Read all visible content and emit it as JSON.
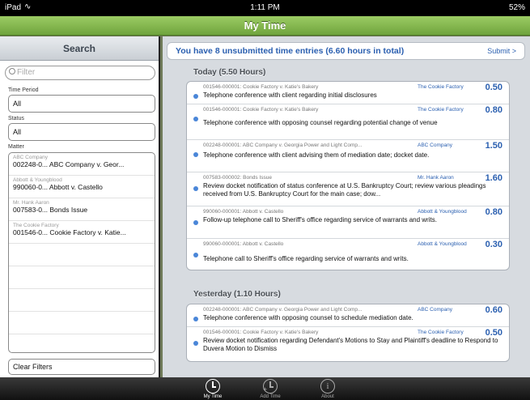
{
  "status_bar": {
    "device": "iPad",
    "time": "1:11 PM",
    "battery": "52%"
  },
  "nav": {
    "title": "My Time"
  },
  "search": {
    "header": "Search",
    "filter_placeholder": "Filter",
    "time_period_label": "Time Period",
    "time_period_value": "All",
    "status_label": "Status",
    "status_value": "All",
    "matter_label": "Matter",
    "matters": [
      {
        "client": "ABC Company",
        "name": "002248-0... ABC Company v. Geor..."
      },
      {
        "client": "Abbott & Youngblood",
        "name": "990060-0... Abbott v. Castello"
      },
      {
        "client": "Mr. Hank Aaron",
        "name": "007583-0... Bonds Issue"
      },
      {
        "client": "The Cookie Factory",
        "name": "001546-0... Cookie Factory v. Katie..."
      }
    ],
    "clear_filters": "Clear Filters"
  },
  "summary": {
    "message": "You have 8 unsubmitted time entries (6.60 hours in total)",
    "submit": "Submit >"
  },
  "sections": [
    {
      "header": "Today   (5.50 Hours)",
      "entries": [
        {
          "matter": "001546-000001: Cookie Factory v. Katie's Bakery",
          "client": "The Cookie Factory",
          "hours": "0.50",
          "description": "Telephone conference with client regarding initial disclosures"
        },
        {
          "matter": "001546-000001: Cookie Factory v. Katie's Bakery",
          "client": "The Cookie Factory",
          "hours": "0.80",
          "description": "Telephone conference with opposing counsel regarding potential change of venue"
        },
        {
          "matter": "002248-000001: ABC Company v. Georgia Power and Light Comp...",
          "client": "ABC Company",
          "hours": "1.50",
          "description": "Telephone conference with client advising them of mediation date; docket date."
        },
        {
          "matter": "007583-000002: Bonds Issue",
          "client": "Mr. Hank Aaron",
          "hours": "1.60",
          "description": "Review docket notification of status conference at U.S. Bankruptcy Court; review various pleadings received from U.S. Bankruptcy Court for the main case; dow..."
        },
        {
          "matter": "990060-000001: Abbott v. Castello",
          "client": "Abbott & Youngblood",
          "hours": "0.80",
          "description": "Follow-up telephone call to Sheriff's office regarding service of warrants and writs."
        },
        {
          "matter": "990060-000001: Abbott v. Castello",
          "client": "Abbott & Youngblood",
          "hours": "0.30",
          "description": "Telephone call to Sheriff's office regarding service of warrants and writs."
        }
      ]
    },
    {
      "header": "Yesterday   (1.10 Hours)",
      "entries": [
        {
          "matter": "002248-000001: ABC Company v. Georgia Power and Light Comp...",
          "client": "ABC Company",
          "hours": "0.60",
          "description": "Telephone conference with opposing counsel to schedule mediation date."
        },
        {
          "matter": "001546-000001: Cookie Factory v. Katie's Bakery",
          "client": "The Cookie Factory",
          "hours": "0.50",
          "description": "Review docket notification regarding Defendant's Motions to Stay and Plaintiff's deadline to Respond to Duvera Motion to Dismiss"
        }
      ]
    }
  ],
  "tabs": [
    {
      "label": "My Time",
      "icon": "clock-icon"
    },
    {
      "label": "Add Time",
      "icon": "add-time-icon"
    },
    {
      "label": "About",
      "icon": "info-icon"
    }
  ]
}
